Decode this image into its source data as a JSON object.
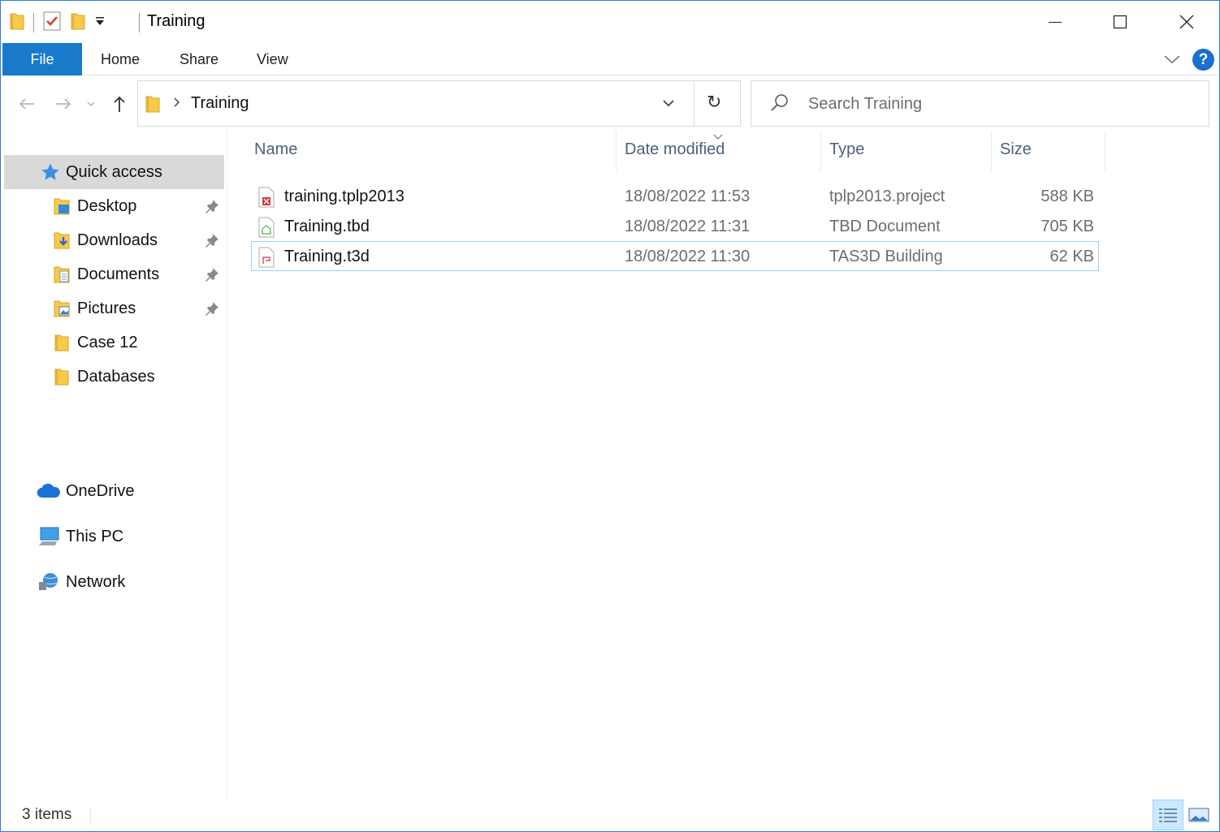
{
  "window": {
    "title": "Training"
  },
  "ribbon": {
    "tabs": [
      {
        "label": "File",
        "active": true
      },
      {
        "label": "Home"
      },
      {
        "label": "Share"
      },
      {
        "label": "View"
      }
    ],
    "help_label": "?"
  },
  "address": {
    "crumb": "Training",
    "refresh_glyph": "↻"
  },
  "search": {
    "placeholder": "Search Training"
  },
  "sidebar": {
    "items": [
      {
        "label": "Quick access",
        "icon": "star-icon",
        "selected": true
      },
      {
        "label": "Desktop",
        "icon": "desktop-folder-icon",
        "pinned": true
      },
      {
        "label": "Downloads",
        "icon": "downloads-folder-icon",
        "pinned": true
      },
      {
        "label": "Documents",
        "icon": "documents-folder-icon",
        "pinned": true
      },
      {
        "label": "Pictures",
        "icon": "pictures-folder-icon",
        "pinned": true
      },
      {
        "label": "Case 12",
        "icon": "folder-icon",
        "pinned": false
      },
      {
        "label": "Databases",
        "icon": "folder-icon",
        "pinned": false
      },
      {
        "label": "OneDrive",
        "icon": "onedrive-cloud-icon"
      },
      {
        "label": "This PC",
        "icon": "computer-icon"
      },
      {
        "label": "Network",
        "icon": "network-icon"
      }
    ]
  },
  "columns": {
    "name": "Name",
    "date": "Date modified",
    "type": "Type",
    "size": "Size"
  },
  "files": [
    {
      "name": "training.tplp2013",
      "date": "18/08/2022 11:53",
      "type": "tplp2013.project",
      "size": "588 KB",
      "icon": "tplp-file-icon"
    },
    {
      "name": "Training.tbd",
      "date": "18/08/2022 11:31",
      "type": "TBD Document",
      "size": "705 KB",
      "icon": "tbd-file-icon"
    },
    {
      "name": "Training.t3d",
      "date": "18/08/2022 11:30",
      "type": "TAS3D Building",
      "size": "62 KB",
      "icon": "t3d-file-icon",
      "focused": true
    }
  ],
  "status": {
    "item_count": "3 items"
  },
  "colors": {
    "accent": "#1979ca",
    "folder": "#f8c94a",
    "selection_border": "#99d1ff",
    "nav_selected": "#d9d9d9"
  }
}
